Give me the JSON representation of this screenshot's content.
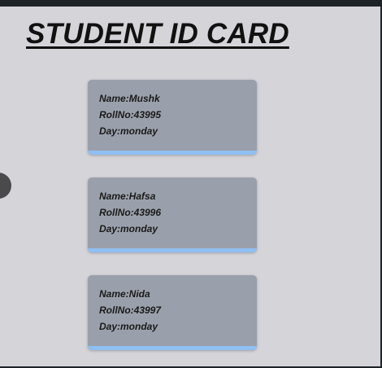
{
  "page": {
    "title": "STUDENT ID CARD"
  },
  "cards": [
    {
      "name": "Name:Mushk",
      "rollno": "RollNo:43995",
      "day": "Day:monday"
    },
    {
      "name": "Name:Hafsa",
      "rollno": "RollNo:43996",
      "day": "Day:monday"
    },
    {
      "name": "Name:Nida",
      "rollno": "RollNo:43997",
      "day": "Day:monday"
    }
  ],
  "colors": {
    "background": "#d5d4d9",
    "card": "#9aa0ab",
    "card_accent": "#8fbff3",
    "title": "#111111"
  }
}
